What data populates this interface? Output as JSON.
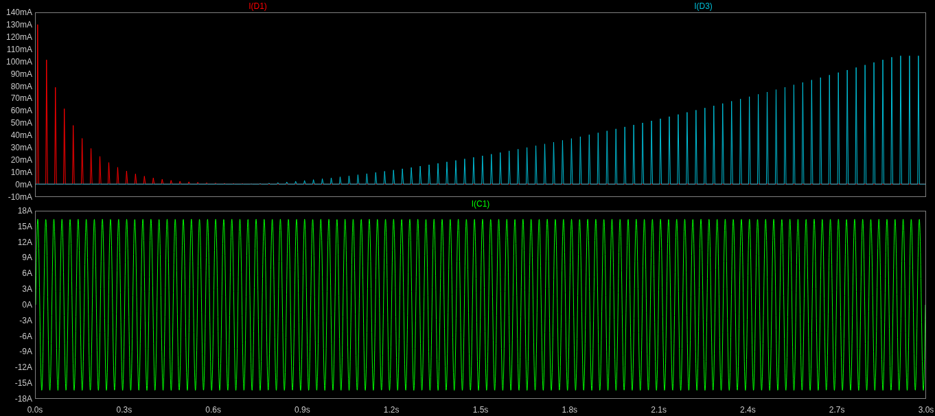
{
  "panes": [
    {
      "traces": [
        {
          "name": "I(D1)",
          "color": "#ff0000",
          "kind": "decaying_spikes"
        },
        {
          "name": "I(D3)",
          "color": "#00bfd8",
          "kind": "growing_spikes"
        }
      ],
      "y_ticks": [
        "140mA",
        "130mA",
        "120mA",
        "110mA",
        "100mA",
        "90mA",
        "80mA",
        "70mA",
        "60mA",
        "50mA",
        "40mA",
        "30mA",
        "20mA",
        "10mA",
        "0mA",
        "-10mA"
      ]
    },
    {
      "traces": [
        {
          "name": "I(C1)",
          "color": "#00ff00",
          "kind": "sine"
        }
      ],
      "y_ticks": [
        "18A",
        "15A",
        "12A",
        "9A",
        "6A",
        "3A",
        "0A",
        "-3A",
        "-6A",
        "-9A",
        "-12A",
        "-15A",
        "-18A"
      ]
    }
  ],
  "x_ticks": [
    "0.0s",
    "0.3s",
    "0.6s",
    "0.9s",
    "1.2s",
    "1.5s",
    "1.8s",
    "2.1s",
    "2.4s",
    "2.7s",
    "3.0s"
  ]
}
